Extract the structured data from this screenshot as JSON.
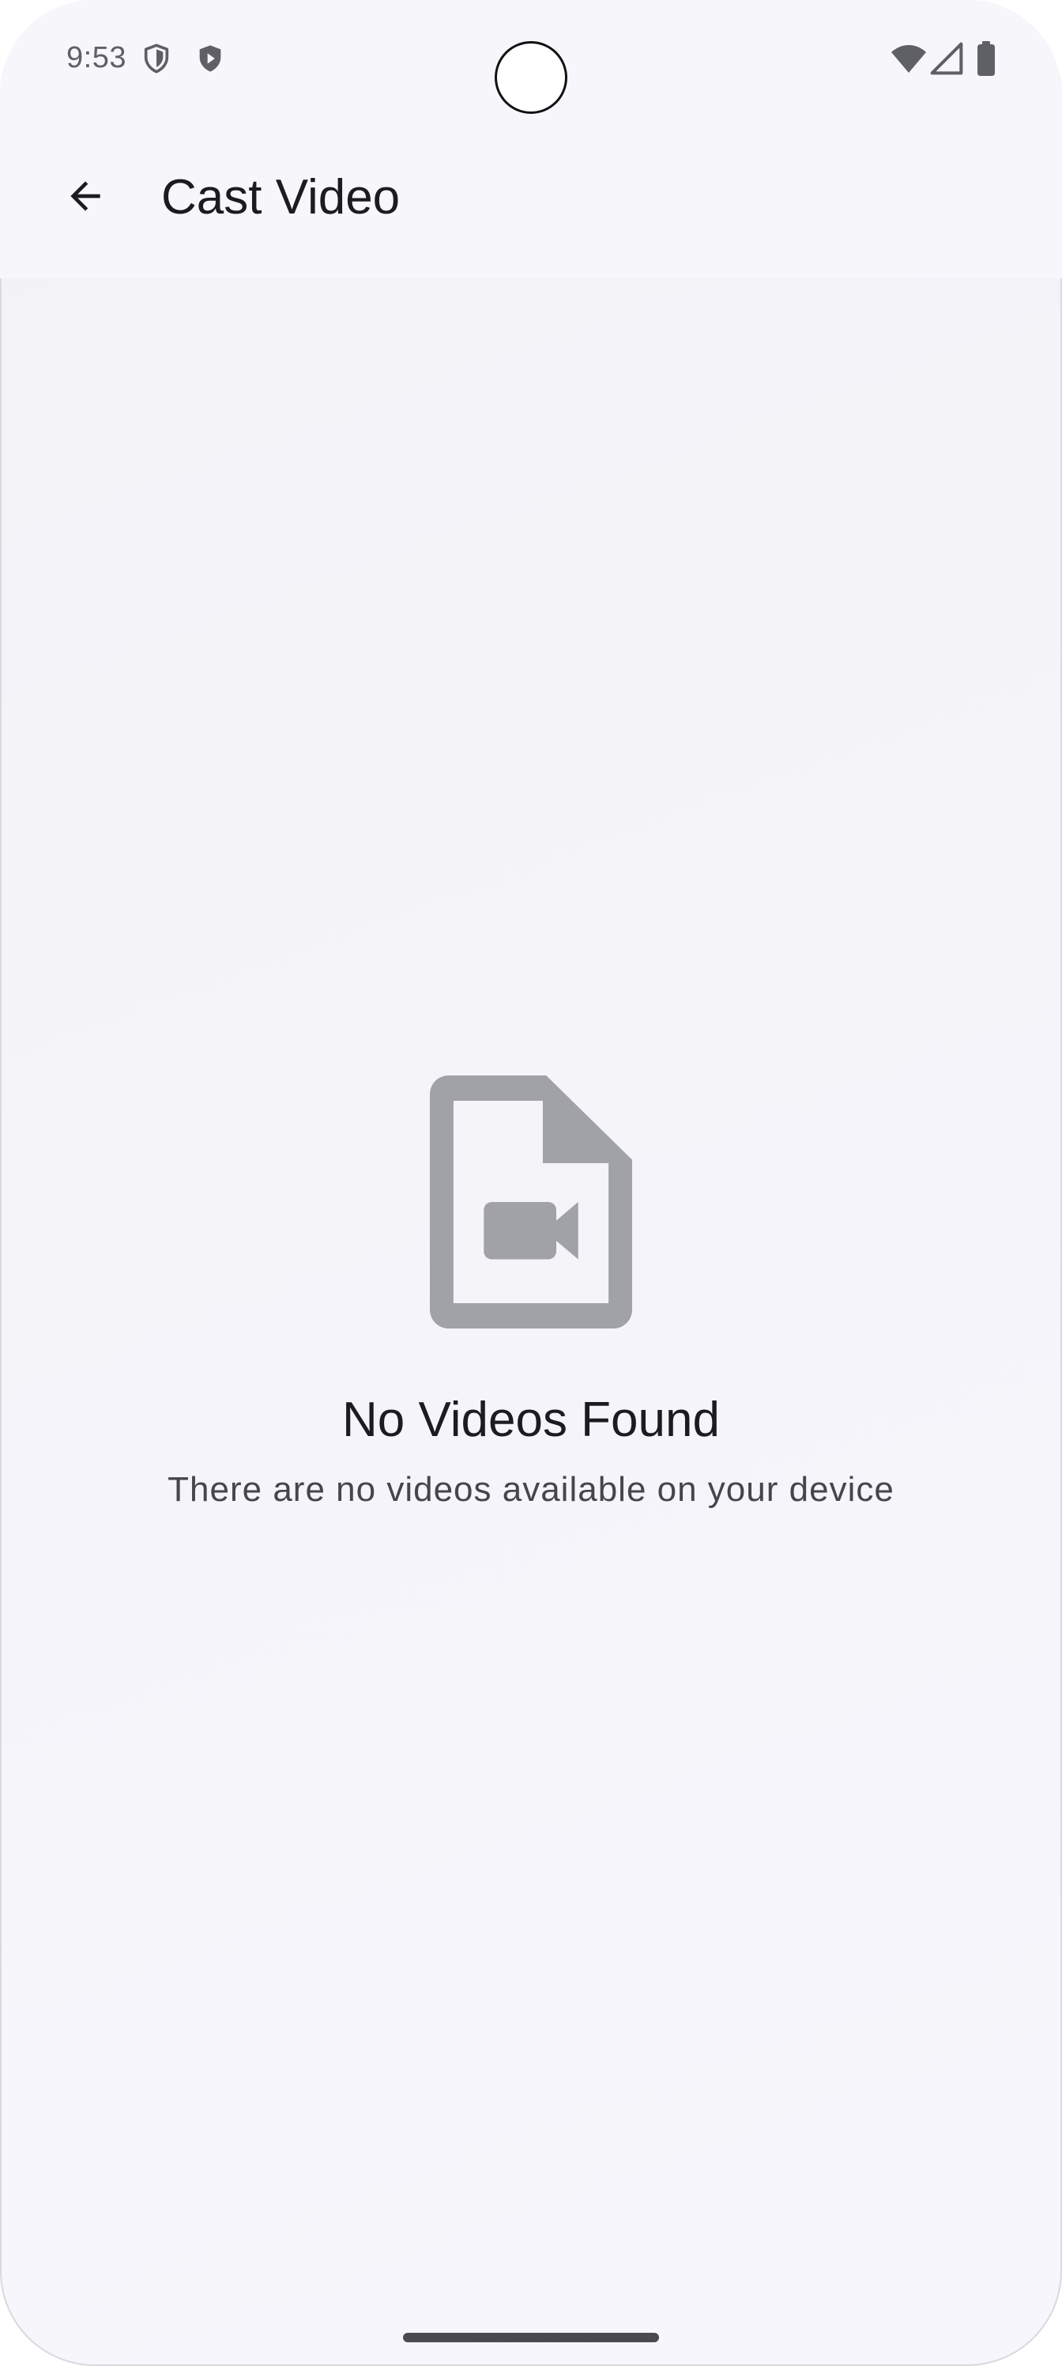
{
  "status_bar": {
    "time": "9:53",
    "left_icons": [
      "vpn-shield-icon",
      "play-shield-icon"
    ],
    "right_icons": [
      "wifi-icon",
      "cell-signal-icon",
      "battery-icon"
    ]
  },
  "app_bar": {
    "back_icon": "arrow-back-icon",
    "title": "Cast Video"
  },
  "empty_state": {
    "icon": "video-file-icon",
    "title": "No Videos Found",
    "subtitle": "There are no videos available on your device"
  },
  "colors": {
    "background": "#f4f4f9",
    "icon_gray": "#a1a1a8",
    "text_primary": "#1c1b20",
    "text_secondary": "#46454d"
  }
}
